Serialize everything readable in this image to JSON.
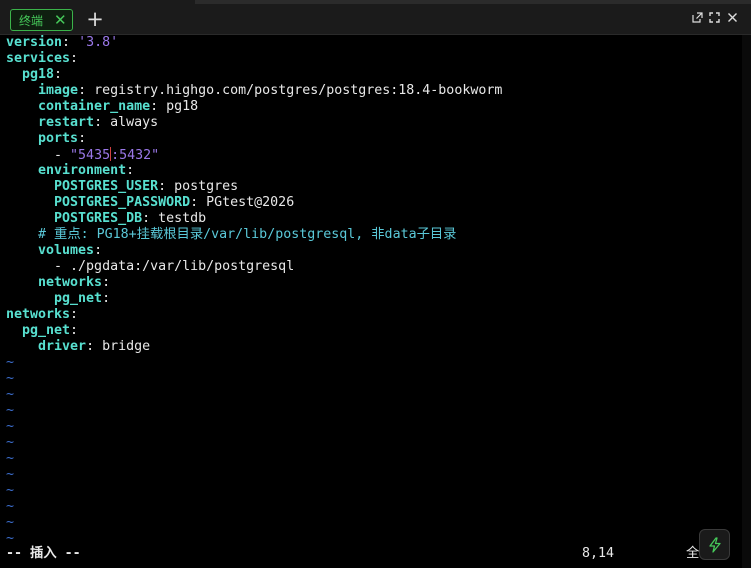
{
  "tab": {
    "label": "终端"
  },
  "window_controls": [
    "popout-icon",
    "expand-icon",
    "close-icon"
  ],
  "editor": {
    "lines": [
      [
        {
          "t": "version",
          "c": "k"
        },
        {
          "t": ": ",
          "c": "p"
        },
        {
          "t": "'3.8'",
          "c": "s"
        }
      ],
      [
        {
          "t": "services",
          "c": "k"
        },
        {
          "t": ":",
          "c": "p"
        }
      ],
      [
        {
          "t": "  pg18",
          "c": "k"
        },
        {
          "t": ":",
          "c": "p"
        }
      ],
      [
        {
          "t": "    image",
          "c": "k"
        },
        {
          "t": ": registry.highgo.com/postgres/postgres:18.4-bookworm",
          "c": "p"
        }
      ],
      [
        {
          "t": "    container_name",
          "c": "k"
        },
        {
          "t": ": pg18",
          "c": "p"
        }
      ],
      [
        {
          "t": "    restart",
          "c": "k"
        },
        {
          "t": ": always",
          "c": "p"
        }
      ],
      [
        {
          "t": "    ports",
          "c": "k"
        },
        {
          "t": ":",
          "c": "p"
        }
      ],
      [
        {
          "t": "      - ",
          "c": "p"
        },
        {
          "t": "\"5435",
          "c": "s"
        },
        {
          "cursor": true
        },
        {
          "t": ":5432\"",
          "c": "s"
        }
      ],
      [
        {
          "t": "    environment",
          "c": "k"
        },
        {
          "t": ":",
          "c": "p"
        }
      ],
      [
        {
          "t": "      POSTGRES_USER",
          "c": "k"
        },
        {
          "t": ": postgres",
          "c": "p"
        }
      ],
      [
        {
          "t": "      POSTGRES_PASSWORD",
          "c": "k"
        },
        {
          "t": ": PGtest@2026",
          "c": "p"
        }
      ],
      [
        {
          "t": "      POSTGRES_DB",
          "c": "k"
        },
        {
          "t": ": testdb",
          "c": "p"
        }
      ],
      [
        {
          "t": "    # 重点: PG18+挂载根目录/var/lib/postgresql, 非data子目录",
          "c": "c"
        }
      ],
      [
        {
          "t": "    volumes",
          "c": "k"
        },
        {
          "t": ":",
          "c": "p"
        }
      ],
      [
        {
          "t": "      - ./pgdata:/var/lib/postgresql",
          "c": "p"
        }
      ],
      [
        {
          "t": "    networks",
          "c": "k"
        },
        {
          "t": ":",
          "c": "p"
        }
      ],
      [
        {
          "t": "      pg_net",
          "c": "k"
        },
        {
          "t": ":",
          "c": "p"
        }
      ],
      [
        {
          "t": "networks",
          "c": "k"
        },
        {
          "t": ":",
          "c": "p"
        }
      ],
      [
        {
          "t": "  pg_net",
          "c": "k"
        },
        {
          "t": ":",
          "c": "p"
        }
      ],
      [
        {
          "t": "    driver",
          "c": "k"
        },
        {
          "t": ": bridge",
          "c": "p"
        }
      ],
      [
        {
          "t": "~",
          "c": "t"
        }
      ],
      [
        {
          "t": "~",
          "c": "t"
        }
      ],
      [
        {
          "t": "~",
          "c": "t"
        }
      ],
      [
        {
          "t": "~",
          "c": "t"
        }
      ],
      [
        {
          "t": "~",
          "c": "t"
        }
      ],
      [
        {
          "t": "~",
          "c": "t"
        }
      ],
      [
        {
          "t": "~",
          "c": "t"
        }
      ],
      [
        {
          "t": "~",
          "c": "t"
        }
      ],
      [
        {
          "t": "~",
          "c": "t"
        }
      ],
      [
        {
          "t": "~",
          "c": "t"
        }
      ],
      [
        {
          "t": "~",
          "c": "t"
        }
      ],
      [
        {
          "t": "~",
          "c": "t"
        }
      ]
    ]
  },
  "status": {
    "mode": "-- 插入 --",
    "position": "8,14",
    "scroll": "全"
  },
  "colors": {
    "key": "#58e0d0",
    "string": "#9a78e8",
    "comment": "#5ac8d8",
    "tilde": "#3c6fd0",
    "accent": "#46c95a"
  }
}
